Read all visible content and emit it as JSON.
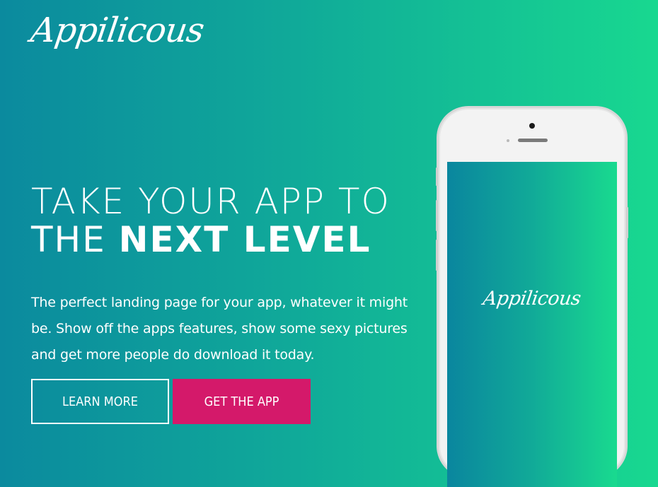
{
  "brand": {
    "logo_text": "Appilicous"
  },
  "hero": {
    "headline_line1": "TAKE YOUR APP TO",
    "headline_line2_light": "THE",
    "headline_line2_bold": "NEXT LEVEL",
    "subcopy": "The perfect landing page for your app, whatever it might be. Show off the apps features, show some sexy pictures and get more people do download it today."
  },
  "buttons": {
    "learn_more": "LEARN MORE",
    "get_app": "GET THE APP"
  },
  "phone": {
    "screen_logo_text": "Appilicous"
  },
  "colors": {
    "gradient_start": "#0b8a9e",
    "gradient_end": "#18d890",
    "cta": "#d4196a",
    "phone_body": "#f3f3f3"
  }
}
